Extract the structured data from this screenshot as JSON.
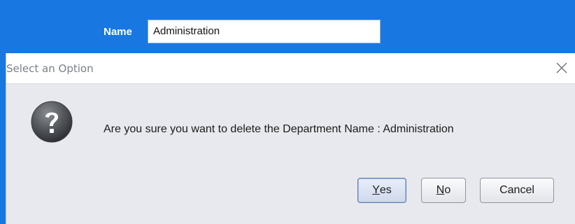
{
  "form": {
    "name_label": "Name",
    "name_value": "Administration"
  },
  "dialog": {
    "title": "Select an Option",
    "message": "Are you sure you want to delete the Department Name : Administration",
    "icon": "question-icon",
    "buttons": {
      "yes_mnemonic": "Y",
      "yes_rest": "es",
      "no_mnemonic": "N",
      "no_rest": "o",
      "cancel_label": "Cancel"
    }
  },
  "colors": {
    "background_blue": "#1877e0",
    "dialog_bg": "#e8e9ee",
    "default_button_border": "#5d7fb0"
  }
}
